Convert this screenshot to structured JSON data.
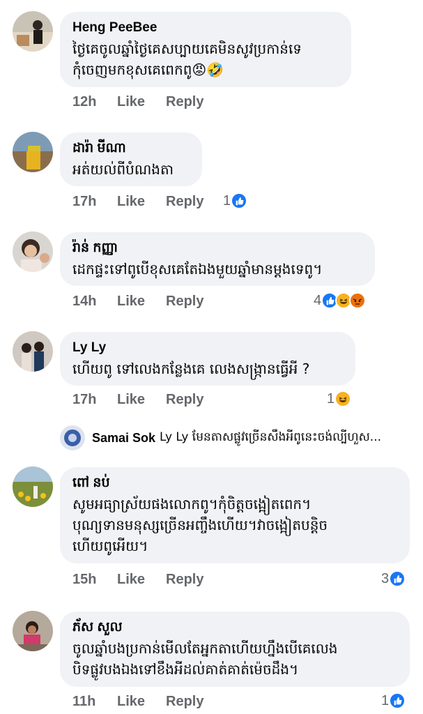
{
  "comments": [
    {
      "name": "Heng PeeBee",
      "text": "ថ្ងៃគេចូលឆ្នាំថ្ងៃគេសប្បាយគេមិនសូវប្រកាន់ទេ\nកុំចេញមកខុសគេពេកពូ😡🤣",
      "time": "12h",
      "like": "Like",
      "reply": "Reply",
      "reactions": [],
      "count": ""
    },
    {
      "name": "ដារ៉ា មីណា",
      "text": "អត់យល់ពីបំណងតា",
      "time": "17h",
      "like": "Like",
      "reply": "Reply",
      "reactions": [
        "like"
      ],
      "count": "1"
    },
    {
      "name": "រ៉ាន់ កញ្ញា",
      "text": "ដេកផ្ទះទៅពូបើខុសគេតែឯងមួយឆ្នាំមានម្តងទេពូ។",
      "time": "14h",
      "like": "Like",
      "reply": "Reply",
      "reactions": [
        "like",
        "haha",
        "angry"
      ],
      "count": "4"
    },
    {
      "name": "Ly Ly",
      "text": "ហើយពូ ទៅលេងកន្លែងគេ លេងសង្ក្រាន​ធ្វើអី ?",
      "time": "17h",
      "like": "Like",
      "reply": "Reply",
      "reactions": [
        "haha"
      ],
      "count": "1"
    },
    {
      "name": "ពៅ នប់",
      "text": "សូមអធ្យាស្រ័យផងលោកពូ។កុំចិត្តចង្អៀតពេក។\nបុណ្យទានមនុស្សច្រើនអញ្ចឹងហើយ។វាចង្អៀតបន្តិច\nហើយពូអើយ។",
      "time": "15h",
      "like": "Like",
      "reply": "Reply",
      "reactions": [
        "like"
      ],
      "count": "3"
    },
    {
      "name": "ភ័ស សួល",
      "text": "ចូលឆ្នាំបងប្រកាន់មើលតែអ្នកតាហើយហ្នឹងបើគេលេង\nបិទផ្លូវបងឯងទៅខឹងអីដល់គាត់គាត់ម៉េចដឹង។",
      "time": "11h",
      "like": "Like",
      "reply": "Reply",
      "reactions": [
        "like"
      ],
      "count": "1"
    }
  ],
  "reply_preview": {
    "name": "Samai Sok",
    "text": "Ly Ly មែនតាសផ្លូវច្រើនសឹងអីពូនេះចង់ល្បីហួស..."
  },
  "colors": {
    "bubble": "#f0f2f5",
    "meta": "#65676b",
    "like": "#1877f2",
    "haha": "#f7b125",
    "angry": "#e9710f"
  }
}
